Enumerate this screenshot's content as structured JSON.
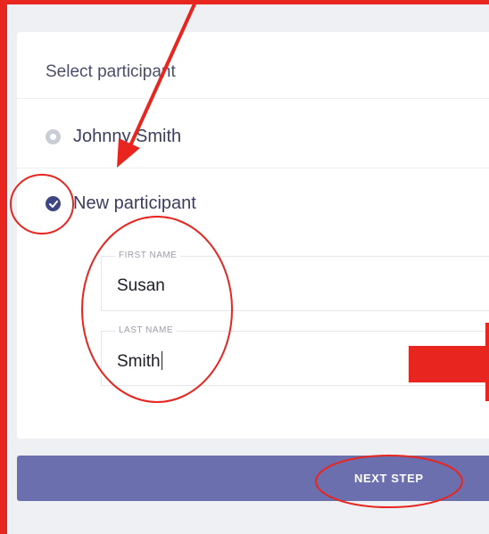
{
  "card": {
    "title": "Select participant",
    "options": [
      {
        "label": "Johnny Smith",
        "selected": false
      },
      {
        "label": "New participant",
        "selected": true
      }
    ],
    "fields": {
      "first_name": {
        "label": "FIRST NAME",
        "value": "Susan"
      },
      "last_name": {
        "label": "LAST NAME",
        "value": "Smith"
      }
    }
  },
  "next_button": {
    "label": "NEXT STEP"
  },
  "annotation": {
    "color": "#e8251f"
  },
  "colors": {
    "accent": "#3f4582",
    "button": "#6b6fae"
  }
}
